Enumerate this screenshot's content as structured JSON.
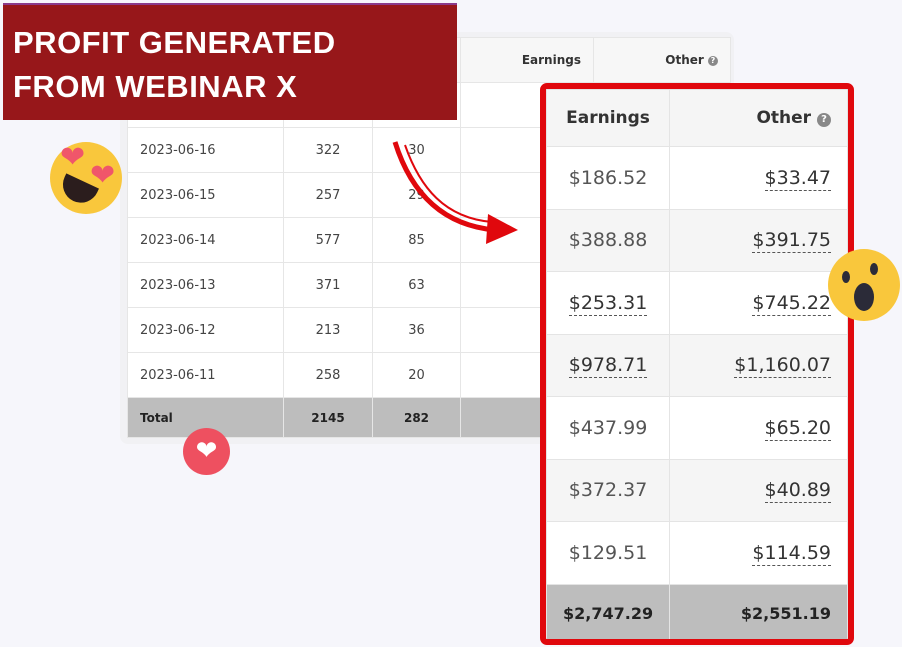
{
  "banner": {
    "line1": "PROFIT GENERATED",
    "line2": "FROM WEBINAR X"
  },
  "background_table": {
    "headers": [
      "",
      "",
      "",
      "Earnings",
      "Other"
    ],
    "rows": [
      [
        "",
        "",
        "",
        "$",
        ""
      ],
      [
        "2023-06-16",
        "322",
        "30",
        "$",
        ""
      ],
      [
        "2023-06-15",
        "257",
        "29",
        "$",
        ""
      ],
      [
        "2023-06-14",
        "577",
        "85",
        "$",
        ""
      ],
      [
        "2023-06-13",
        "371",
        "63",
        "$",
        ""
      ],
      [
        "2023-06-12",
        "213",
        "36",
        "$",
        ""
      ],
      [
        "2023-06-11",
        "258",
        "20",
        "$",
        ""
      ]
    ],
    "total": [
      "Total",
      "2145",
      "282",
      "$2,",
      ""
    ]
  },
  "zoom_table": {
    "headers": {
      "earnings": "Earnings",
      "other": "Other"
    },
    "rows": [
      {
        "earnings": "$186.52",
        "other": "$33.47",
        "earnings_link": false
      },
      {
        "earnings": "$388.88",
        "other": "$391.75",
        "earnings_link": false
      },
      {
        "earnings": "$253.31",
        "other": "$745.22",
        "earnings_link": true
      },
      {
        "earnings": "$978.71",
        "other": "$1,160.07",
        "earnings_link": true
      },
      {
        "earnings": "$437.99",
        "other": "$65.20",
        "earnings_link": false
      },
      {
        "earnings": "$372.37",
        "other": "$40.89",
        "earnings_link": false
      },
      {
        "earnings": "$129.51",
        "other": "$114.59",
        "earnings_link": false
      }
    ],
    "total": {
      "earnings": "$2,747.29",
      "other": "$2,551.19"
    }
  },
  "icons": {
    "help": "question-circle-icon",
    "emoji1": "heart-eyes-emoji",
    "emoji2": "surprised-emoji",
    "badge": "heart-icon",
    "arrow": "curved-arrow"
  },
  "colors": {
    "banner": "#97171a",
    "highlight_border": "#e0080d",
    "total_row": "#bdbdbd"
  }
}
